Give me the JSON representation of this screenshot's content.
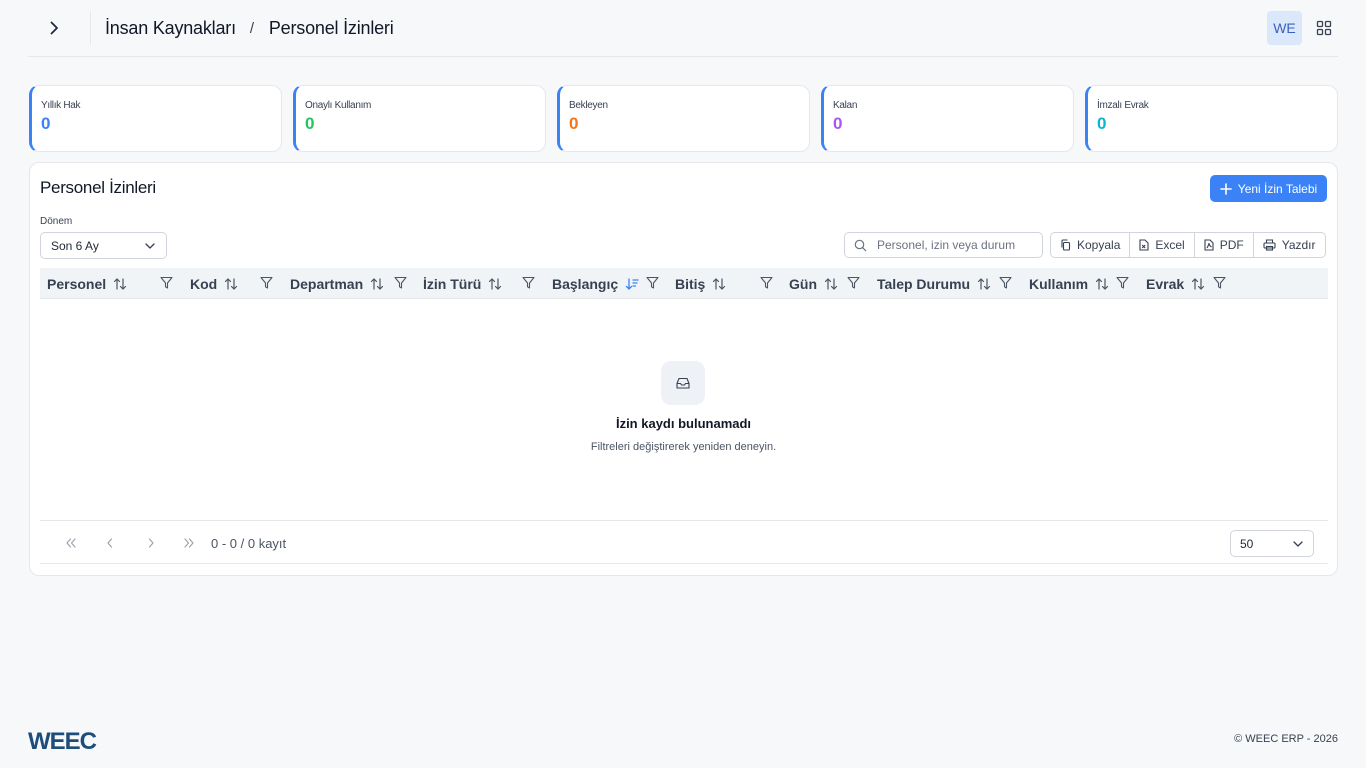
{
  "header": {
    "breadcrumb": [
      "İnsan Kaynakları",
      "Personel İzinleri"
    ],
    "separator": "/",
    "avatar_initials": "WE"
  },
  "stats": [
    {
      "label": "Yıllık Hak",
      "value": "0",
      "color": "#3b82f6"
    },
    {
      "label": "Onaylı Kullanım",
      "value": "0",
      "color": "#22c55e"
    },
    {
      "label": "Bekleyen",
      "value": "0",
      "color": "#f97316"
    },
    {
      "label": "Kalan",
      "value": "0",
      "color": "#a855f7"
    },
    {
      "label": "İmzalı Evrak",
      "value": "0",
      "color": "#06b6d4"
    }
  ],
  "panel": {
    "title": "Personel İzinleri",
    "new_button": "Yeni İzin Talebi",
    "period_label": "Dönem",
    "period_value": "Son 6 Ay",
    "search_placeholder": "Personel, izin veya durum",
    "exports": [
      "Kopyala",
      "Excel",
      "PDF",
      "Yazdır"
    ]
  },
  "table": {
    "columns": [
      "Personel",
      "Kod",
      "Departman",
      "İzin Türü",
      "Başlangıç",
      "Bitiş",
      "Gün",
      "Talep Durumu",
      "Kullanım",
      "Evrak"
    ],
    "sorted_column": "Başlangıç",
    "empty_title": "İzin kaydı bulunamadı",
    "empty_subtitle": "Filtreleri değiştirerek yeniden deneyin.",
    "page_info": "0 - 0 / 0 kayıt",
    "page_size": "50"
  },
  "footer": {
    "brand": "WEEC",
    "copyright": "© WEEC ERP - 2026"
  },
  "colors": {
    "accent": "#3b82f6"
  }
}
